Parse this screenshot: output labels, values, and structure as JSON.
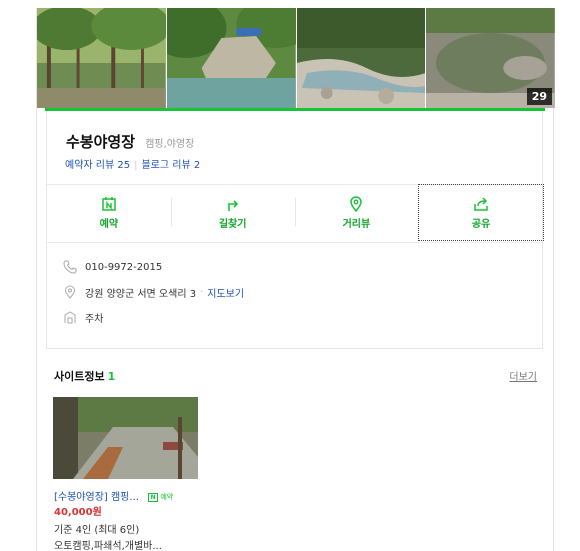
{
  "photos": {
    "count": "29"
  },
  "place": {
    "name": "수봉야영장",
    "category": "캠핑,야영장",
    "visitor_review": "예약자 리뷰 25",
    "blog_review": "블로그 리뷰 2"
  },
  "actions": [
    {
      "label": "예약",
      "icon": "calendar-n-icon"
    },
    {
      "label": "길찾기",
      "icon": "route-arrow-icon"
    },
    {
      "label": "거리뷰",
      "icon": "map-pin-icon"
    },
    {
      "label": "공유",
      "icon": "share-icon"
    }
  ],
  "info": {
    "phone": "010-9972-2015",
    "address": "강원 양양군 서면 오색리 3",
    "map_link": "지도보기",
    "amenity": "주차"
  },
  "site_info": {
    "title": "사이트정보",
    "count": "1",
    "more_label": "더보기",
    "item": {
      "title": "[수봉야영장] 캠핑...",
      "badge": "예약",
      "price": "40,000원",
      "capacity": "기준 4인 (최대 6인)",
      "features": "오토캠핑,파쇄석,개별바..."
    }
  },
  "colors": {
    "accent": "#19c337",
    "link": "#1f52b7",
    "price": "#d93434"
  }
}
